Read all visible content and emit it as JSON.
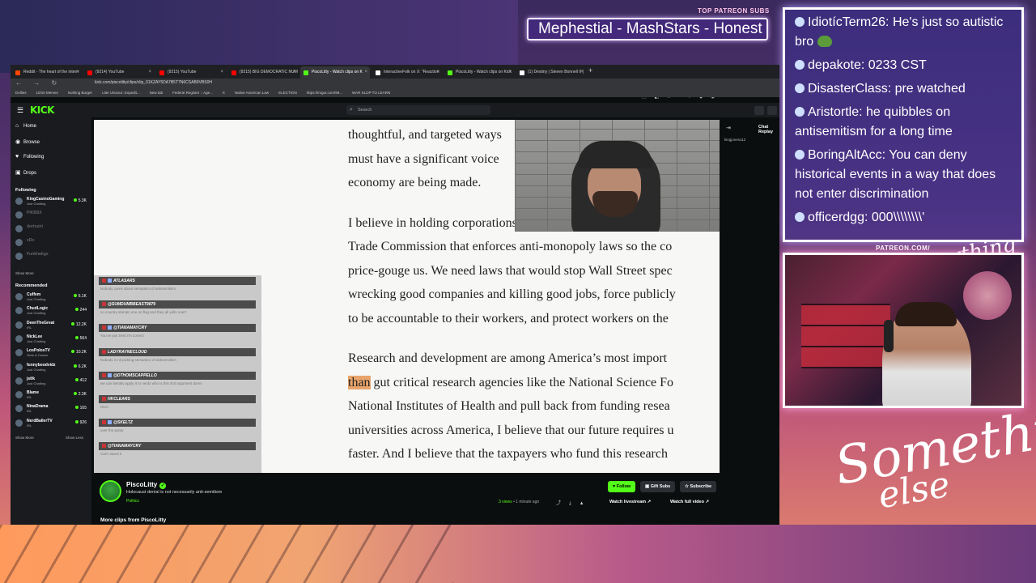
{
  "overlay": {
    "patreon_subs_label": "TOP PATREON SUBS",
    "ticker_text": "Mephestial - MashStars - Honest",
    "patreon_url": "PATREON.COM/",
    "logo_top": "Anything else?",
    "logo_line1": "Something",
    "logo_line2": "else"
  },
  "stream_chat": [
    {
      "user": "IdiotícTerm26",
      "text": "He's just so autistic bro"
    },
    {
      "user": "depakote",
      "text": "0233 CST"
    },
    {
      "user": "DisasterClass",
      "text": "pre watched"
    },
    {
      "user": "Aristortle",
      "text": "he quibbles on antisemitism for a long time"
    },
    {
      "user": "BoringAltAcc",
      "text": "You can deny historical events in a way that does not enter discrimination"
    },
    {
      "user": "officerdgg",
      "text": "000\\\\\\\\\\\\\\\\'"
    }
  ],
  "browser": {
    "tabs": [
      {
        "label": "Reddit - The heart of the intern",
        "color": "#ff4500"
      },
      {
        "label": "(9214) YouTube",
        "color": "#ff0000"
      },
      {
        "label": "(9215) YouTube",
        "color": "#ff0000"
      },
      {
        "label": "(9215) BIG DEMOCRATIC NUM",
        "color": "#ff0000"
      },
      {
        "label": "PiscoLitty - Watch clips on K",
        "color": "#53fc18"
      },
      {
        "label": "InteractiveFolk on X: \"Reaction",
        "color": "#ffffff"
      },
      {
        "label": "PiscoLitty - Watch clips on Kick",
        "color": "#53fc18"
      },
      {
        "label": "(1) Destiny | Steven Bonnell II (",
        "color": "#ffffff"
      }
    ],
    "url": "kick.com/piscolitty/clips/clip_01KZAY5DA7B5T7N6CSAB9VBS0H",
    "bookmarks": [
      "Dollies",
      "10/10 Memes",
      "Nothing Burger",
      "Liter Ulssour: Expedit...",
      "New tab",
      "Federal Register :: Age...",
      "X",
      "Native American Law",
      "ELECTION",
      "https://imgur.com/99...",
      "WAR SLOP TO LEARN"
    ]
  },
  "kick": {
    "logo": "KICK",
    "search_placeholder": "Search",
    "nav": [
      {
        "label": "Home",
        "icon": "home-icon",
        "glyph": "⌂"
      },
      {
        "label": "Browse",
        "icon": "compass-icon",
        "glyph": "◉"
      },
      {
        "label": "Following",
        "icon": "heart-icon",
        "glyph": "♥"
      },
      {
        "label": "Drops",
        "icon": "gift-icon",
        "glyph": "▣"
      }
    ],
    "following_heading": "Following",
    "following": [
      {
        "name": "KingCasinoGaming",
        "category": "Just Chatting",
        "viewers": "5.3K",
        "dim": false
      },
      {
        "name": "PIKBSX",
        "category": "",
        "viewers": "",
        "dim": true
      },
      {
        "name": "dortssiri",
        "category": "",
        "viewers": "",
        "dim": true
      },
      {
        "name": "vDo",
        "category": "",
        "viewers": "",
        "dim": true
      },
      {
        "name": "Funkhahgs",
        "category": "",
        "viewers": "",
        "dim": true
      }
    ],
    "show_more": "Show More",
    "recommended_heading": "Recommended",
    "recommended": [
      {
        "name": "Cuffem",
        "category": "Just Chatting",
        "viewers": "6.1K"
      },
      {
        "name": "ChudLogic",
        "category": "Just Chatting",
        "viewers": "244"
      },
      {
        "name": "DeenTheGreat",
        "category": "IRL",
        "viewers": "12.2K"
      },
      {
        "name": "NickLee",
        "category": "Just Chatting",
        "viewers": "564"
      },
      {
        "name": "LosPolosTV",
        "category": "Slots & Casino",
        "viewers": "10.2K"
      },
      {
        "name": "funnyboodvidz",
        "category": "Just Chatting",
        "viewers": "6.2K"
      },
      {
        "name": "jstlk",
        "category": "Just Chatting",
        "viewers": "412"
      },
      {
        "name": "Blame",
        "category": "IRL",
        "viewers": "2.3K"
      },
      {
        "name": "NinaDrama",
        "category": "IRL",
        "viewers": "165"
      },
      {
        "name": "NerdBallerTV",
        "category": "IRL",
        "viewers": "926"
      }
    ],
    "show_less": "Show Less",
    "chat_header": "Chat Replay",
    "chat_line": "kingjones112"
  },
  "video": {
    "paragraphs": [
      [
        "thoughtful, and targeted ways",
        "must have a significant voice",
        "economy are being made."
      ],
      [
        "I believe in holding corporations",
        "Trade Commission that enforces anti-monopoly laws so the co",
        "price-gouge us. We need laws that would stop Wall Street spec",
        "wrecking good companies and killing good jobs, force publicly",
        "to be accountable to their workers, and protect workers on the"
      ],
      [
        "Research and development are among America’s most import",
        " gut critical research agencies like the National Science Fo",
        "National Institutes of Health and pull back from funding resea",
        "universities across America, I believe that our future requires u",
        "faster. And I believe that the taxpayers who fund this research"
      ]
    ],
    "highlight": "than",
    "inner_chat": [
      {
        "user": "ATLASARS",
        "text": "Nobody cares about semantics of antisemitism"
      },
      {
        "user": "@SUMDUMBBEAST9879",
        "text": "so country stamps one on flag and they all yells now?"
      },
      {
        "user": "@TIANAMAYCRY",
        "text": "You've just tried I'm correct"
      },
      {
        "user": "LADYRAYNECLOUD",
        "text": "Nobody is nit picking semantics of antisemitism"
      },
      {
        "user": "@DTHOMSCAPPELLO",
        "text": "we can literally apply it to nerds who is this shit argument damn"
      },
      {
        "user": "HKCLEARS",
        "text": "HUH"
      },
      {
        "user": "@SKELTZ",
        "text": "over the punty"
      },
      {
        "user": "@TIANAMAYCRY",
        "text": "Can't stand it"
      }
    ]
  },
  "clip_info": {
    "streamer": "PiscoLitty",
    "title": "Holocaust denial is not necessarily anti-semitism",
    "category": "Politics",
    "follow": "Follow",
    "gift_subs": "Gift Subs",
    "subscribe": "Subscribe",
    "views": "3 views",
    "time": "• 1 minute ago",
    "watch_livestream": "Watch livestream",
    "watch_full_video": "Watch full video",
    "more_clips": "More clips from PiscoLitty"
  }
}
